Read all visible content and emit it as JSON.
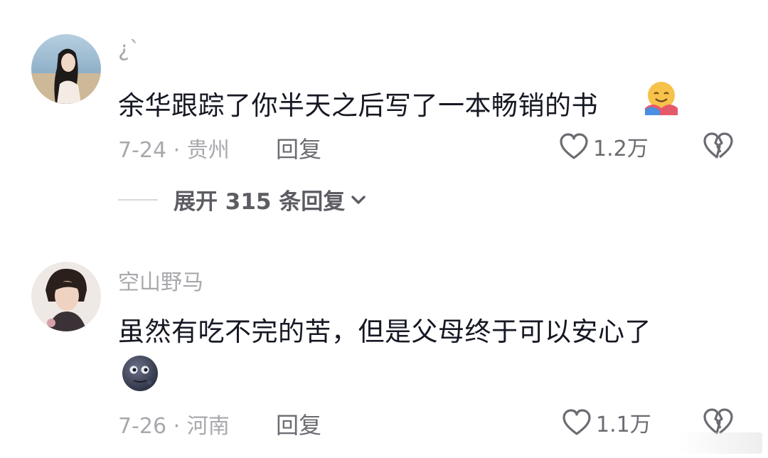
{
  "comments": [
    {
      "username": "¿`",
      "text": "余华跟踪了你半天之后写了一本畅销的书",
      "emoji": "hugging-face",
      "meta": "7-24 · 贵州",
      "reply_label": "回复",
      "likes": "1.2万",
      "expand_label": "展开 315 条回复"
    },
    {
      "username": "空山野马",
      "text": "虽然有吃不完的苦，但是父母终于可以安心了",
      "emoji": "new-moon-face",
      "meta": "7-26 · 河南",
      "reply_label": "回复",
      "likes": "1.1万"
    }
  ],
  "colors": {
    "primary_text": "#161823",
    "secondary_text": "#a8a8ad",
    "action_text": "#6b6b72"
  },
  "icons": [
    "heart-outline-icon",
    "broken-heart-icon",
    "chevron-down-icon"
  ]
}
